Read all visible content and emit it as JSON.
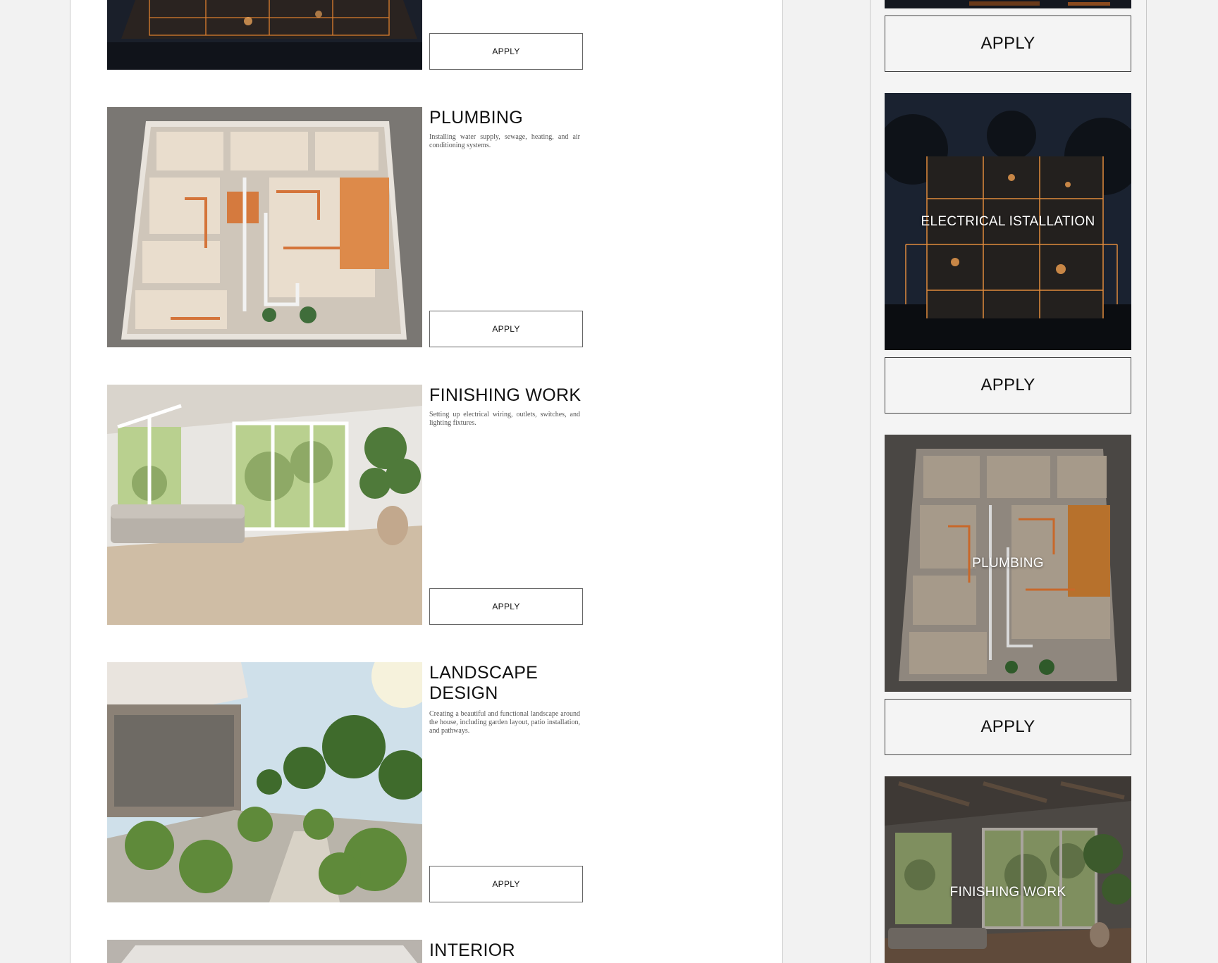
{
  "left_list": {
    "apply_label": "APPLY",
    "items": [
      {
        "id": "electrical",
        "image": "electrical-house-image"
      },
      {
        "id": "plumbing",
        "title": "PLUMBING",
        "description": "Installing water supply, sewage, heating, and air conditioning systems.",
        "image": "plumbing-floorplan-image"
      },
      {
        "id": "finishing",
        "title": "FINISHING WORK",
        "description": "Setting up electrical wiring, outlets, switches, and lighting fixtures.",
        "image": "living-room-image"
      },
      {
        "id": "landscape",
        "title": "LANDSCAPE DESIGN",
        "description": "Creating a beautiful and functional landscape around the house, including garden layout, patio installation, and pathways.",
        "image": "garden-image"
      },
      {
        "id": "interior",
        "title": "INTERIOR",
        "image": "interior-image"
      }
    ]
  },
  "right_cards": {
    "apply_label": "APPLY",
    "cards": [
      {
        "id": "electrical",
        "label": "ELECTRICAL ISTALLATION"
      },
      {
        "id": "plumbing",
        "label": "PLUMBING"
      },
      {
        "id": "finishing",
        "label": "FINISHING WORK"
      }
    ]
  },
  "colors": {
    "accent_orange": "#e08a3c",
    "dark": "#141820",
    "border": "#666666"
  }
}
